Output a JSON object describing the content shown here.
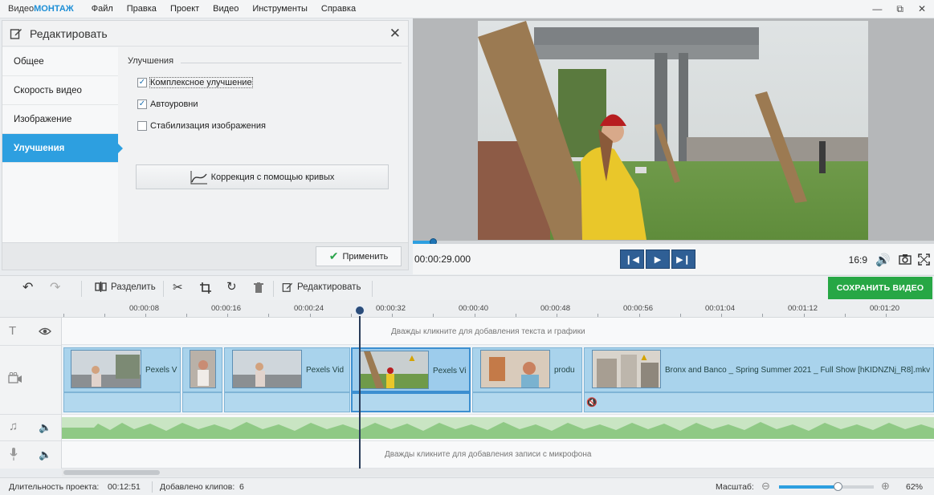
{
  "app": {
    "logo_part1": "Видео",
    "logo_part2": "МОНТАЖ"
  },
  "menu": [
    "Файл",
    "Правка",
    "Проект",
    "Видео",
    "Инструменты",
    "Справка"
  ],
  "edit_panel": {
    "title": "Редактировать",
    "tabs": [
      "Общее",
      "Скорость видео",
      "Изображение",
      "Улучшения"
    ],
    "active_tab": "Улучшения",
    "section_title": "Улучшения",
    "options": [
      {
        "label": "Комплексное улучшение",
        "checked": true
      },
      {
        "label": "Автоуровни",
        "checked": true
      },
      {
        "label": "Стабилизация изображения",
        "checked": false
      }
    ],
    "curves_button": "Коррекция с помощью кривых",
    "apply_button": "Применить"
  },
  "player": {
    "timecode": "00:00:29.000",
    "aspect_ratio": "16:9",
    "progress": 0.04
  },
  "toolbar": {
    "split_label": "Разделить",
    "edit_label": "Редактировать",
    "save_label": "СОХРАНИТЬ ВИДЕО"
  },
  "ruler": [
    "00:00:08",
    "00:00:16",
    "00:00:24",
    "00:00:32",
    "00:00:40",
    "00:00:48",
    "00:00:56",
    "00:01:04",
    "00:01:12",
    "00:01:20"
  ],
  "timeline": {
    "text_hint": "Дважды кликните для добавления текста и графики",
    "mic_hint": "Дважды кликните для добавления записи с микрофона",
    "clips": [
      {
        "label": "Pexels V"
      },
      {
        "label": ""
      },
      {
        "label": "Pexels Vid"
      },
      {
        "label": "Pexels Vi"
      },
      {
        "label": "produ"
      },
      {
        "label": "Bronx and Banco _ Spring Summer 2021 _ Full Show [hKIDNZNj_R8].mkv"
      }
    ]
  },
  "status": {
    "duration_label": "Длительность проекта:",
    "duration_value": "00:12:51",
    "clips_label": "Добавлено клипов:",
    "clips_value": "6",
    "zoom_label": "Масштаб:",
    "zoom_value": "62%",
    "zoom_level": 0.62
  },
  "colors": {
    "accent": "#2d9fe0",
    "save": "#27a745",
    "play_buttons": "#2f5f95"
  },
  "icons": [
    "edit-icon",
    "close-icon",
    "curve-icon",
    "check-icon",
    "undo-icon",
    "redo-icon",
    "split-icon",
    "scissors-icon",
    "crop-icon",
    "rotate-icon",
    "trash-icon",
    "text-icon",
    "eye-icon",
    "video-track-icon",
    "music-icon",
    "speaker-icon",
    "mic-icon",
    "volume-icon",
    "camera-icon",
    "fullscreen-icon",
    "muted-icon"
  ]
}
